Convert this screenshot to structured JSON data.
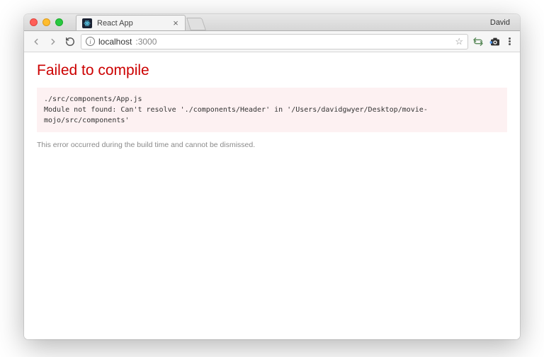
{
  "window": {
    "tab_title": "React App",
    "profile_name": "David"
  },
  "toolbar": {
    "url_host": "localhost",
    "url_port": ":3000"
  },
  "error": {
    "heading": "Failed to compile",
    "file_line": "./src/components/App.js",
    "message_line": "Module not found: Can't resolve './components/Header' in '/Users/davidgwyer/Desktop/movie-mojo/src/components'",
    "note": "This error occurred during the build time and cannot be dismissed."
  }
}
